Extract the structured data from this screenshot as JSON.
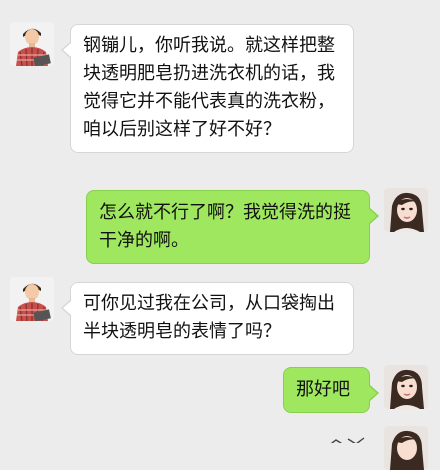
{
  "messages": [
    {
      "side": "left",
      "sender": "male",
      "text": "钢镚儿，你听我说。就这样把整块透明肥皂扔进洗衣机的话，我觉得它并不能代表真的洗衣粉，咱以后别这样了好不好？"
    },
    {
      "side": "right",
      "sender": "female",
      "text": "怎么就不行了啊？我觉得洗的挺干净的啊。"
    },
    {
      "side": "left",
      "sender": "male",
      "text": "可你见过我在公司，从口袋掏出半块透明皂的表情了吗？"
    },
    {
      "side": "right",
      "sender": "female",
      "text": "那好吧"
    }
  ],
  "colors": {
    "background": "#ececec",
    "left_bubble": "#ffffff",
    "right_bubble": "#9fe75e"
  },
  "icons": {
    "male_avatar": "man-avatar-icon",
    "female_avatar": "woman-avatar-icon"
  }
}
